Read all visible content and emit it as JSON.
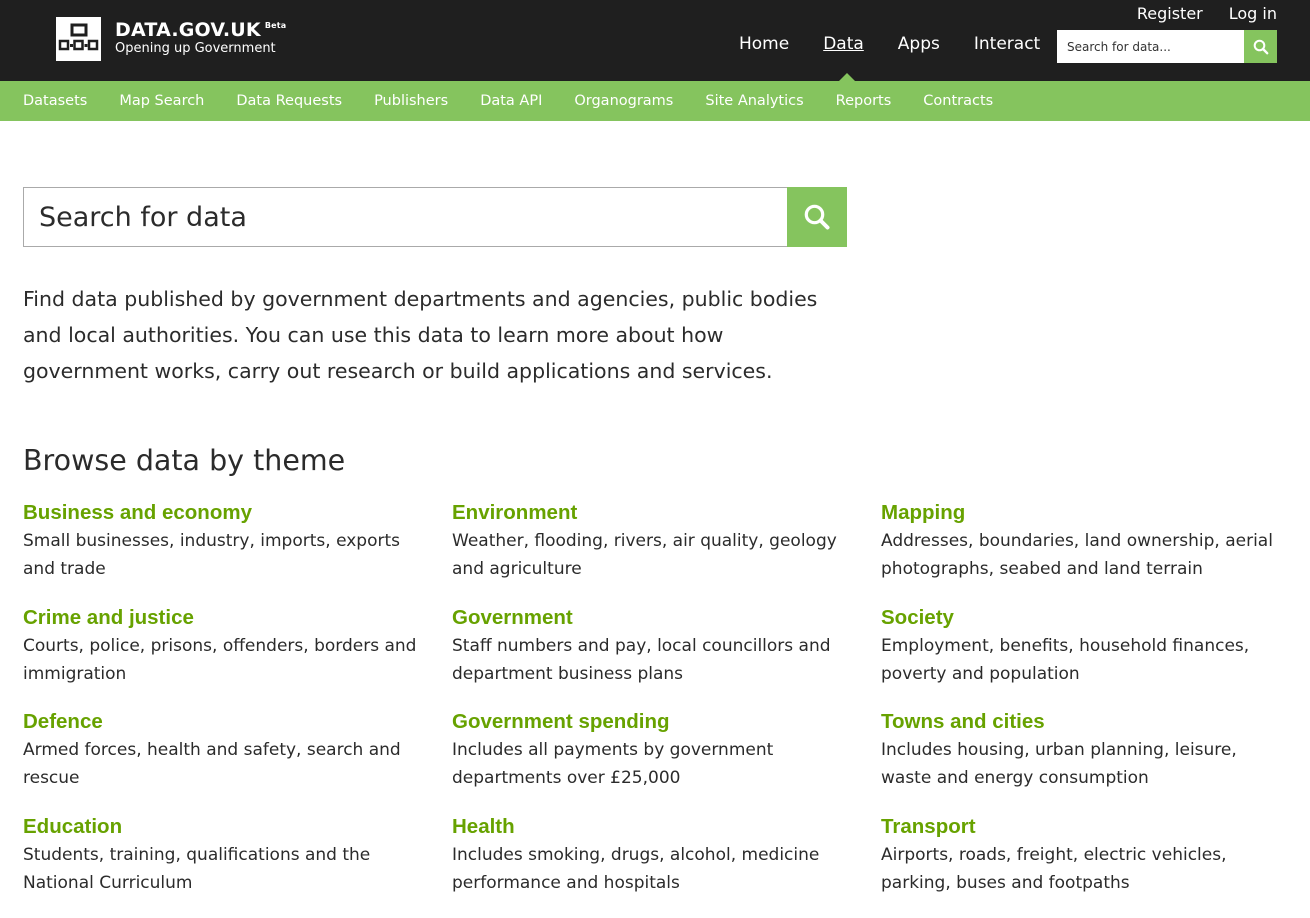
{
  "brand": {
    "title": "DATA.GOV.UK",
    "badge": "Beta",
    "subtitle": "Opening up Government"
  },
  "account": {
    "register": "Register",
    "login": "Log in"
  },
  "main_nav": {
    "home": "Home",
    "data": "Data",
    "apps": "Apps",
    "interact": "Interact"
  },
  "header_search": {
    "placeholder": "Search for data..."
  },
  "sub_nav": {
    "datasets": "Datasets",
    "map_search": "Map Search",
    "data_requests": "Data Requests",
    "publishers": "Publishers",
    "data_api": "Data API",
    "organograms": "Organograms",
    "site_analytics": "Site Analytics",
    "reports": "Reports",
    "contracts": "Contracts"
  },
  "main_search": {
    "placeholder": "Search for data"
  },
  "intro": "Find data published by government departments and agencies, public bodies and local authorities. You can use this data to learn more about how government works, carry out research or build applications and services.",
  "browse": {
    "title": "Browse data by theme",
    "themes": [
      {
        "name": "Business and economy",
        "desc": "Small businesses, industry, imports, exports and trade"
      },
      {
        "name": "Environment",
        "desc": "Weather, flooding, rivers, air quality, geology and agriculture"
      },
      {
        "name": "Mapping",
        "desc": "Addresses, boundaries, land ownership, aerial photographs, seabed and land terrain"
      },
      {
        "name": "Crime and justice",
        "desc": "Courts, police, prisons, offenders, borders and immigration"
      },
      {
        "name": "Government",
        "desc": "Staff numbers and pay, local councillors and department business plans"
      },
      {
        "name": "Society",
        "desc": "Employment, benefits, household finances, poverty and population"
      },
      {
        "name": "Defence",
        "desc": "Armed forces, health and safety, search and rescue"
      },
      {
        "name": "Government spending",
        "desc": "Includes all payments by government departments over £25,000"
      },
      {
        "name": "Towns and cities",
        "desc": "Includes housing, urban planning, leisure, waste and energy consumption"
      },
      {
        "name": "Education",
        "desc": "Students, training, qualifications and the National Curriculum"
      },
      {
        "name": "Health",
        "desc": "Includes smoking, drugs, alcohol, medicine performance and hospitals"
      },
      {
        "name": "Transport",
        "desc": "Airports, roads, freight, electric vehicles, parking, buses and footpaths"
      }
    ]
  },
  "colors": {
    "header_bg": "#1f1f1f",
    "accent_green": "#85c45e",
    "link_green": "#67a200"
  }
}
